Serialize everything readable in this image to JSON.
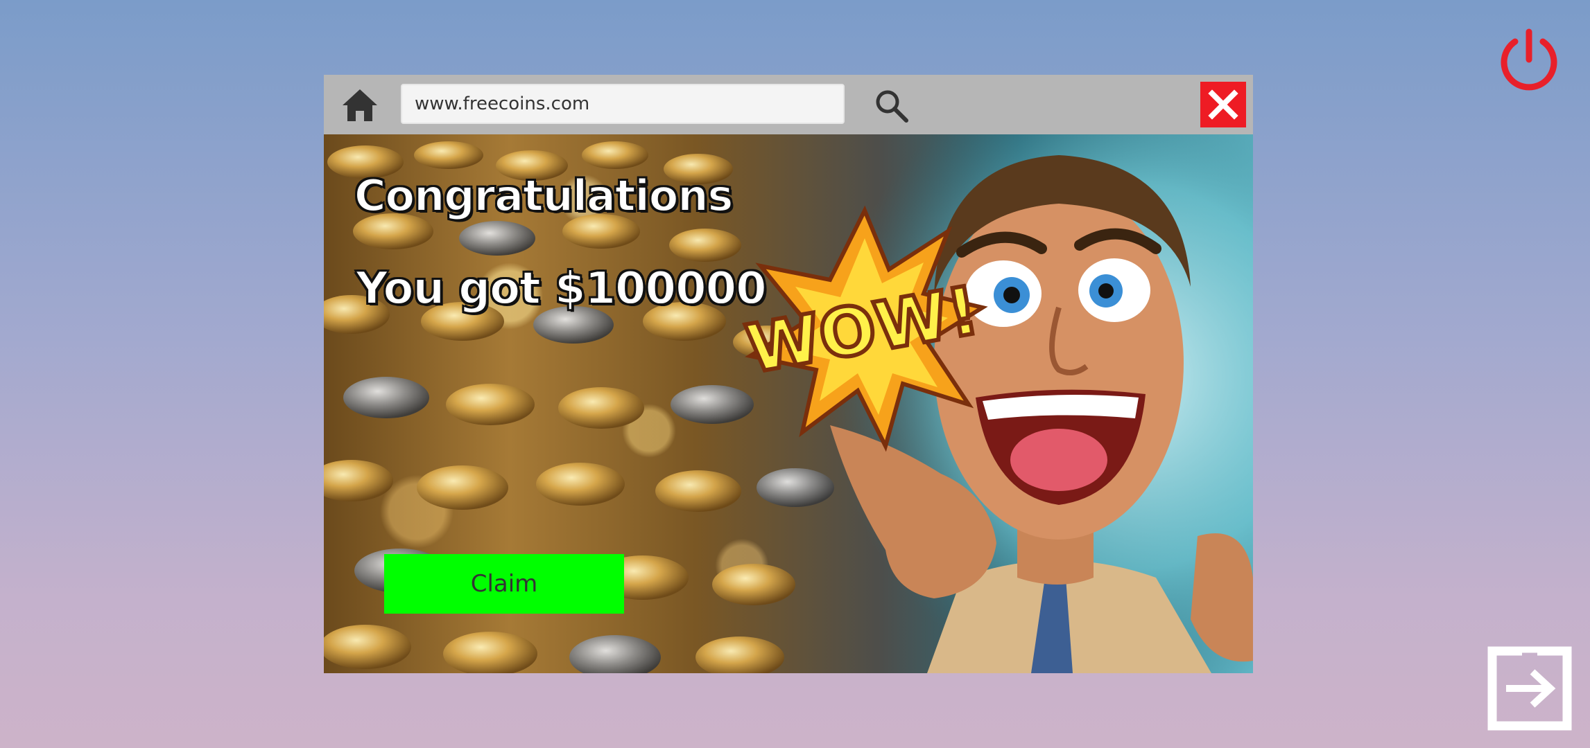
{
  "browser": {
    "url": "www.freecoins.com",
    "home_icon": "home-icon",
    "search_icon": "search-icon",
    "close_icon": "close-icon"
  },
  "ad": {
    "headline": "Congratulations",
    "prize_text": "You got $100000",
    "claim_label": "Claim",
    "burst_text": "WOW!"
  },
  "system": {
    "power_icon": "power-icon",
    "exit_icon": "exit-icon"
  },
  "colors": {
    "close_button": "#ee1c24",
    "claim_button": "#00ff00",
    "power_icon": "#e8202a",
    "toolbar": "#b6b6b6"
  }
}
